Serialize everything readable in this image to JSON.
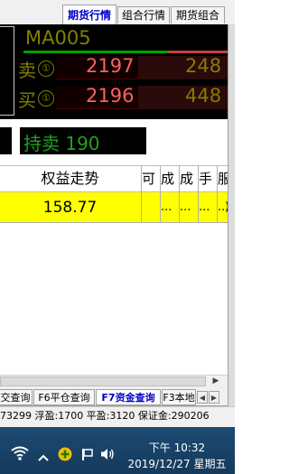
{
  "tabs": [
    {
      "label": "期货行情",
      "active": true
    },
    {
      "label": "组合行情",
      "active": false
    },
    {
      "label": "期货组合",
      "active": false
    }
  ],
  "quote": {
    "contract": "MA005",
    "sell": {
      "label": "卖",
      "level": "①",
      "price": "2197",
      "qty": "248"
    },
    "buy": {
      "label": "买",
      "level": "①",
      "price": "2196",
      "qty": "448"
    }
  },
  "position": {
    "label": "持卖",
    "value": "190"
  },
  "grid": {
    "headers": [
      "权益走势",
      "可",
      "成",
      "成",
      "手",
      "服"
    ],
    "row": [
      "158.77",
      "",
      "...",
      "...",
      "...",
      "...",
      ")"
    ]
  },
  "bottom_tabs": [
    {
      "label": "交查询",
      "active": false
    },
    {
      "label": "F6平仓查询",
      "active": false
    },
    {
      "label": "F7资金查询",
      "active": true
    },
    {
      "label": "F3本地",
      "active": false
    }
  ],
  "status": "73299 浮盈:1700 平盈:3120 保证金:290206",
  "taskbar": {
    "time": "下午 10:32",
    "date": "2019/12/27 星期五"
  },
  "icons": [
    "wifi-icon",
    "add-icon",
    "flag-icon",
    "volume-icon"
  ]
}
